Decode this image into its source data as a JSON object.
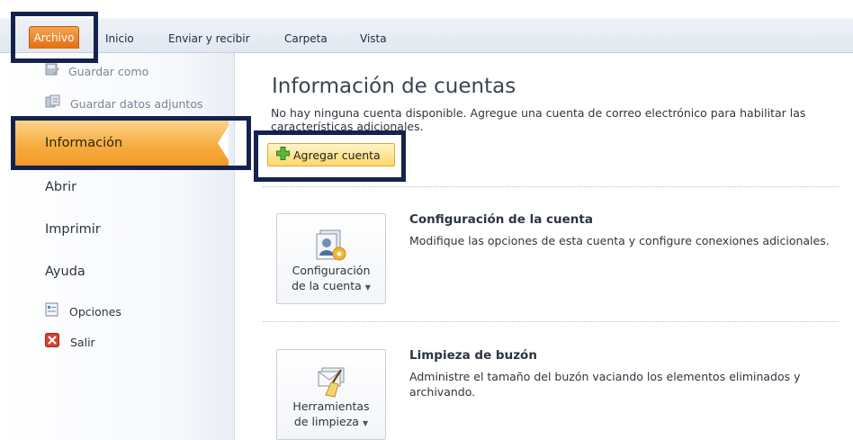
{
  "ribbon": {
    "tabs": [
      "Archivo",
      "Inicio",
      "Enviar y recibir",
      "Carpeta",
      "Vista"
    ]
  },
  "backstage": {
    "save_as": "Guardar como",
    "save_attachments": "Guardar datos adjuntos",
    "info": "Información",
    "open": "Abrir",
    "print": "Imprimir",
    "help": "Ayuda",
    "options": "Opciones",
    "exit": "Salir"
  },
  "content": {
    "title": "Información de cuentas",
    "notice": "No hay ninguna cuenta disponible. Agregue una cuenta de correo electrónico para habilitar las características adicionales.",
    "add_account": "Agregar cuenta",
    "account_settings": {
      "button_line1": "Configuración",
      "button_line2": "de la cuenta",
      "title": "Configuración de la cuenta",
      "description": "Modifique las opciones de esta cuenta y configure conexiones adicionales."
    },
    "mailbox_cleanup": {
      "button_line1": "Herramientas",
      "button_line2": "de limpieza",
      "title": "Limpieza de buzón",
      "description": "Administre el tamaño del buzón vaciando los elementos eliminados y archivando."
    }
  },
  "colors": {
    "archivo_tab": "#e36e12",
    "selected_nav": "#f6ad42",
    "highlight_frame": "#14224d",
    "add_button": "#fbd86b"
  }
}
